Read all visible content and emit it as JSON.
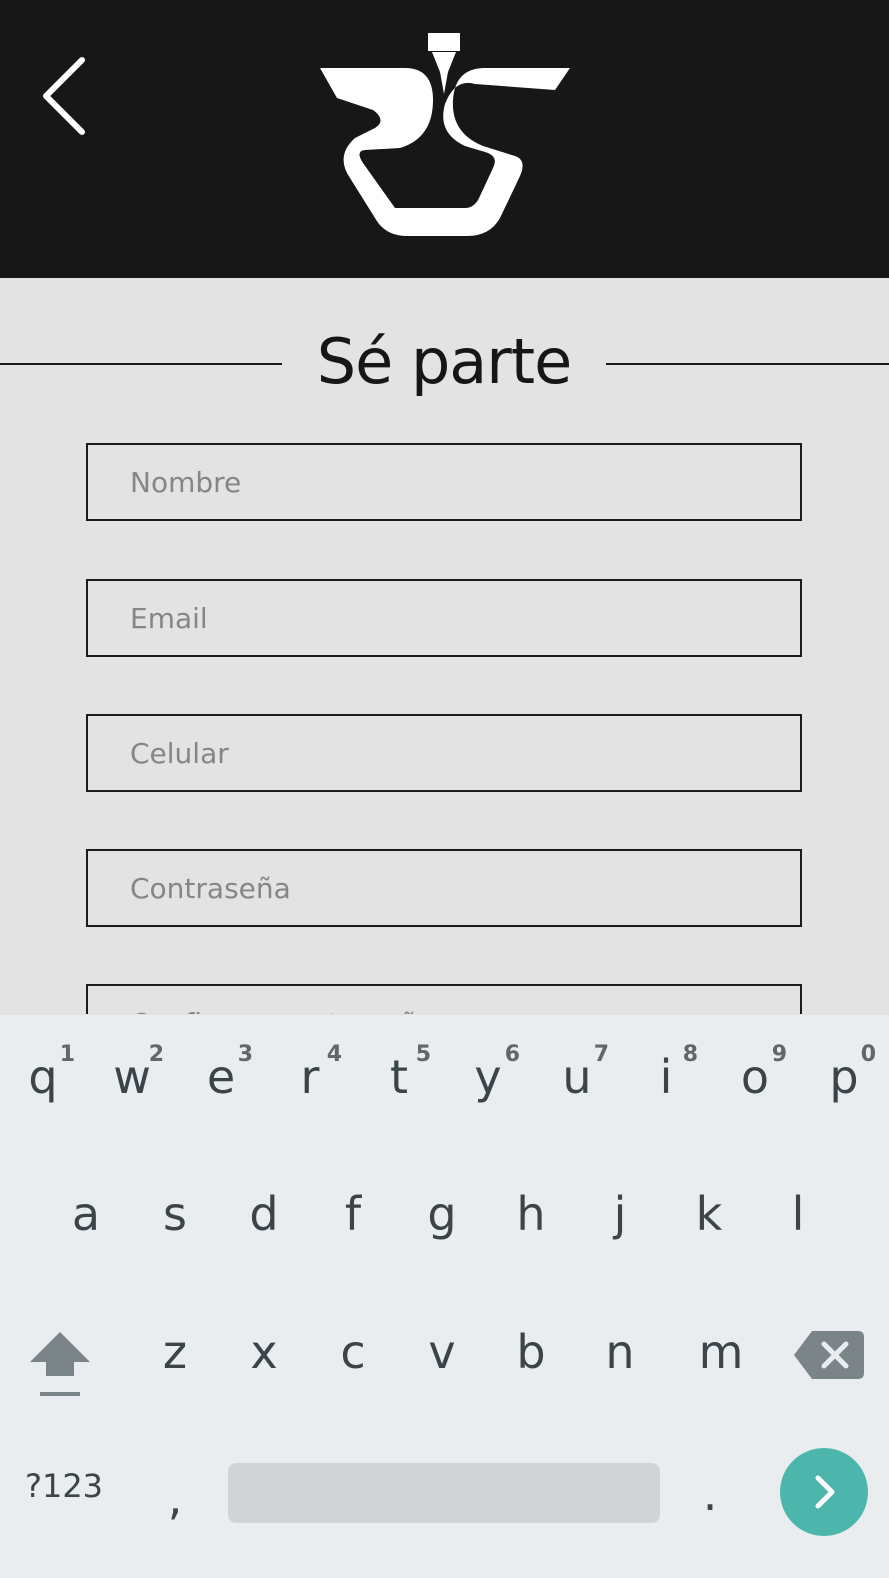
{
  "header": {
    "back_icon": "chevron-left-icon",
    "logo": "rjs-logo"
  },
  "title": "Sé parte",
  "form": {
    "fields": [
      {
        "name": "nombre",
        "placeholder": "Nombre"
      },
      {
        "name": "email",
        "placeholder": "Email"
      },
      {
        "name": "celular",
        "placeholder": "Celular"
      },
      {
        "name": "contrasena",
        "placeholder": "Contraseña"
      },
      {
        "name": "confirmar",
        "placeholder": "Confirmar contraseña"
      }
    ]
  },
  "keyboard": {
    "row1": [
      "q",
      "w",
      "e",
      "r",
      "t",
      "y",
      "u",
      "i",
      "o",
      "p"
    ],
    "row1_hints": [
      "1",
      "2",
      "3",
      "4",
      "5",
      "6",
      "7",
      "8",
      "9",
      "0"
    ],
    "row2": [
      "a",
      "s",
      "d",
      "f",
      "g",
      "h",
      "j",
      "k",
      "l"
    ],
    "row3": [
      "z",
      "x",
      "c",
      "v",
      "b",
      "n",
      "m"
    ],
    "symbols_label": "?123",
    "comma": ",",
    "period": ".",
    "shift_icon": "shift-icon",
    "backspace_icon": "backspace-icon",
    "enter_icon": "chevron-right-icon",
    "accent_color": "#4db6ac"
  }
}
